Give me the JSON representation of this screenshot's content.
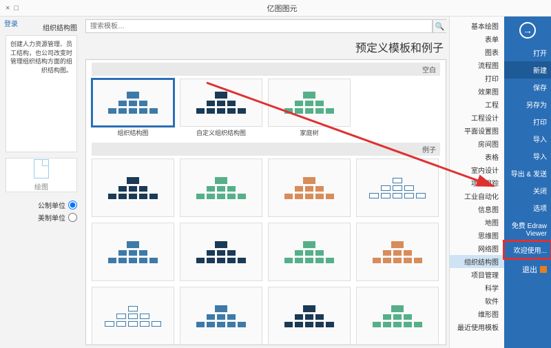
{
  "titlebar": {
    "title": "亿图图元"
  },
  "login_link": "登录",
  "left": {
    "header": "组织结构图",
    "description": "创建人力资源管理、员工结构，也公司改变时管理组织结构方面的组织结构图。",
    "blank_label": "绘图",
    "opt_company": "公制单位",
    "opt_us": "美制单位"
  },
  "search": {
    "placeholder": "搜索模板…"
  },
  "big_title": "预定义模板和例子",
  "sections": {
    "empty_label": "空白",
    "examples_label": "例子"
  },
  "empty_templates": [
    {
      "caption": "组织结构图",
      "selected": true
    },
    {
      "caption": "自定义组织结构图"
    },
    {
      "caption": "家庭树"
    }
  ],
  "example_count": 12,
  "categories": [
    "基本绘图",
    "表单",
    "图表",
    "流程图",
    "打印",
    "效果图",
    "工程",
    "工程设计",
    "平面设置图",
    "房间图",
    "表格",
    "室内设计",
    "项目跟踪",
    "工业自动化",
    "信息图",
    "地图",
    "思维图",
    "网络图",
    "组织结构图",
    "项目管理",
    "科学",
    "软件",
    "维形图",
    "最近使用模板"
  ],
  "selected_category_index": 18,
  "sidebar": {
    "items": [
      "打开",
      "新建",
      "保存",
      "另存为",
      "打印",
      "导入",
      "导入",
      "导出 & 发送",
      "关闭",
      "选项",
      "免费 Edraw Viewer",
      "欢迎使用..."
    ],
    "active_index": 1,
    "highlight_index": 11,
    "exit_label": "退出"
  }
}
